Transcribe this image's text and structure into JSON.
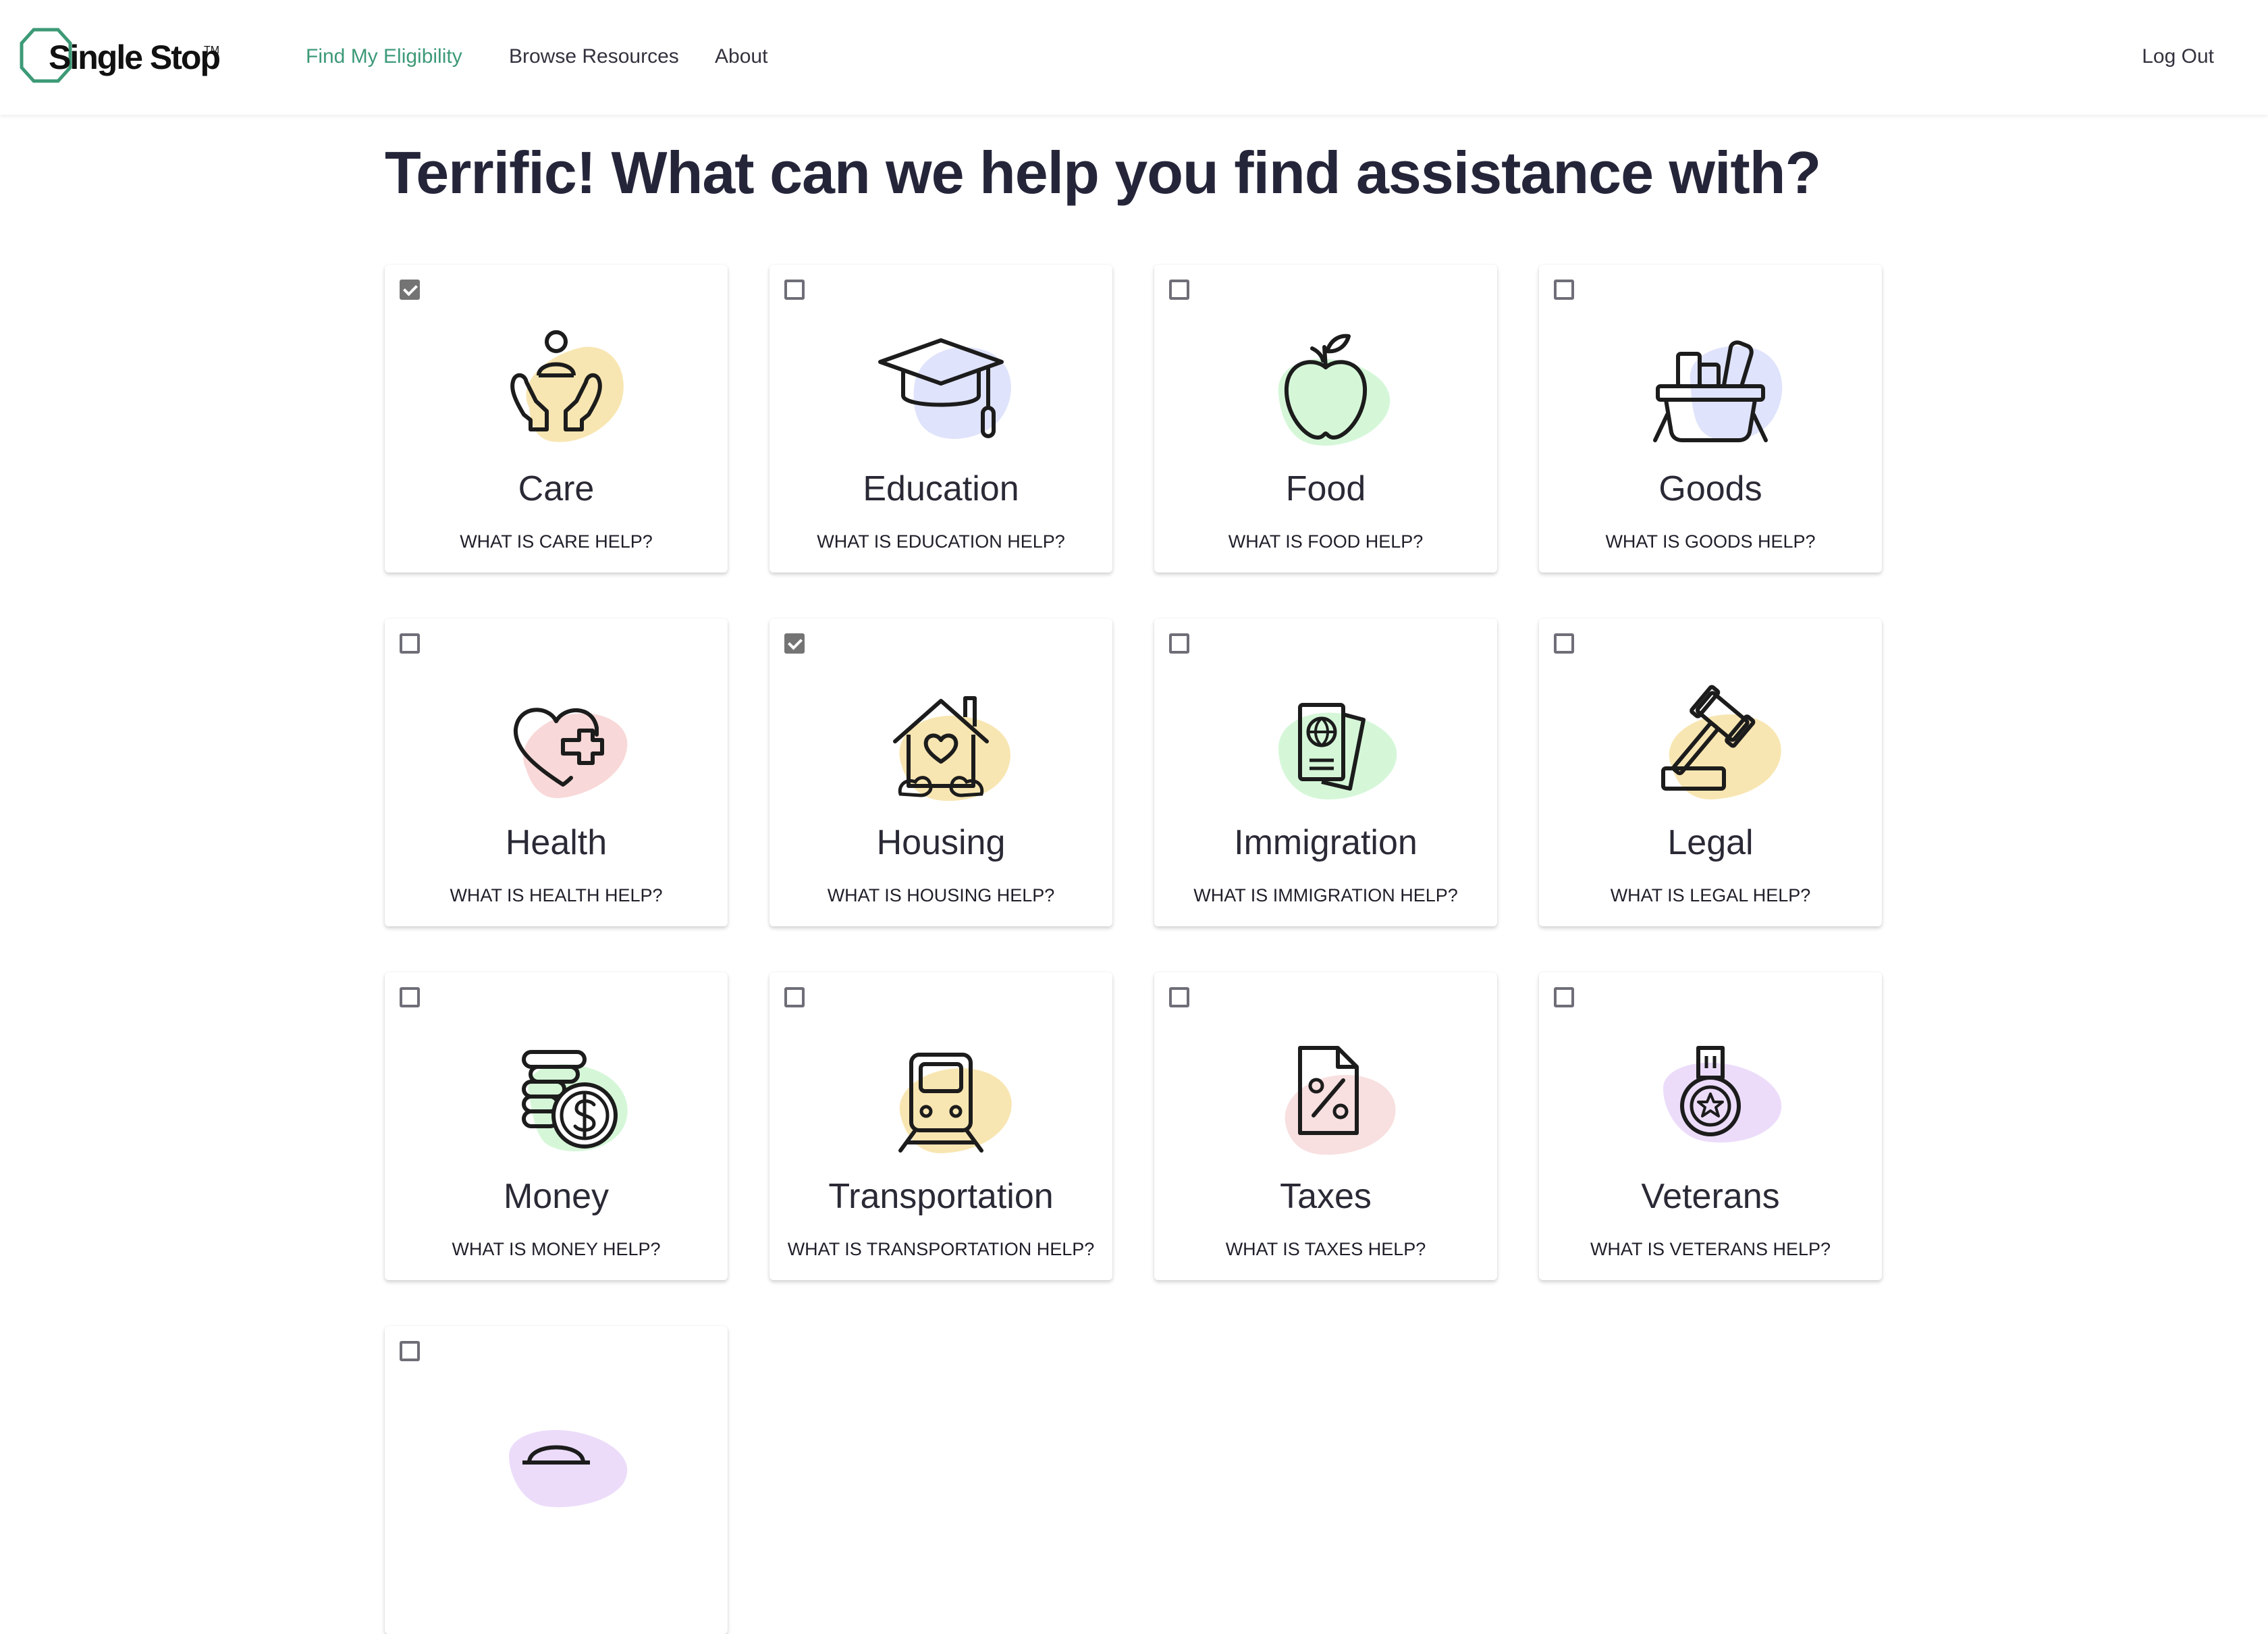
{
  "header": {
    "logo_text": "Single Stop",
    "logo_tm": "TM",
    "nav": [
      {
        "label": "Find My Eligibility",
        "active": true
      },
      {
        "label": "Browse Resources",
        "active": false
      },
      {
        "label": "About",
        "active": false
      }
    ],
    "logout_label": "Log Out",
    "accent_color": "#3d9a77"
  },
  "page_title": "Terrific! What can we help you find assistance with?",
  "categories": [
    {
      "title": "Care",
      "link": "WHAT IS CARE HELP?",
      "checked": true,
      "icon": "care-hands-icon",
      "blob_color": "#f8e6b2"
    },
    {
      "title": "Education",
      "link": "WHAT IS EDUCATION HELP?",
      "checked": false,
      "icon": "graduation-cap-icon",
      "blob_color": "#dfe3fb"
    },
    {
      "title": "Food",
      "link": "WHAT IS FOOD HELP?",
      "checked": false,
      "icon": "apple-icon",
      "blob_color": "#d5f7d8"
    },
    {
      "title": "Goods",
      "link": "WHAT IS GOODS HELP?",
      "checked": false,
      "icon": "basket-icon",
      "blob_color": "#dfe3fb"
    },
    {
      "title": "Health",
      "link": "WHAT IS HEALTH HELP?",
      "checked": false,
      "icon": "heart-plus-icon",
      "blob_color": "#f8d8d8"
    },
    {
      "title": "Housing",
      "link": "WHAT IS HOUSING HELP?",
      "checked": true,
      "icon": "house-heart-icon",
      "blob_color": "#f8e6b2"
    },
    {
      "title": "Immigration",
      "link": "WHAT IS IMMIGRATION HELP?",
      "checked": false,
      "icon": "passport-icon",
      "blob_color": "#d5f7d8"
    },
    {
      "title": "Legal",
      "link": "WHAT IS LEGAL HELP?",
      "checked": false,
      "icon": "gavel-icon",
      "blob_color": "#f8e6b2"
    },
    {
      "title": "Money",
      "link": "WHAT IS MONEY HELP?",
      "checked": false,
      "icon": "coins-dollar-icon",
      "blob_color": "#d5f7d8"
    },
    {
      "title": "Transportation",
      "link": "WHAT IS TRANSPORTATION HELP?",
      "checked": false,
      "icon": "train-icon",
      "blob_color": "#f8e6b2"
    },
    {
      "title": "Taxes",
      "link": "WHAT IS TAXES HELP?",
      "checked": false,
      "icon": "tax-document-icon",
      "blob_color": "#f8dfe0"
    },
    {
      "title": "Veterans",
      "link": "WHAT IS VETERANS HELP?",
      "checked": false,
      "icon": "medal-icon",
      "blob_color": "#ecdcfa"
    },
    {
      "title": "",
      "link": "",
      "checked": false,
      "icon": "partial-icon",
      "blob_color": "#ecdcfa"
    }
  ]
}
